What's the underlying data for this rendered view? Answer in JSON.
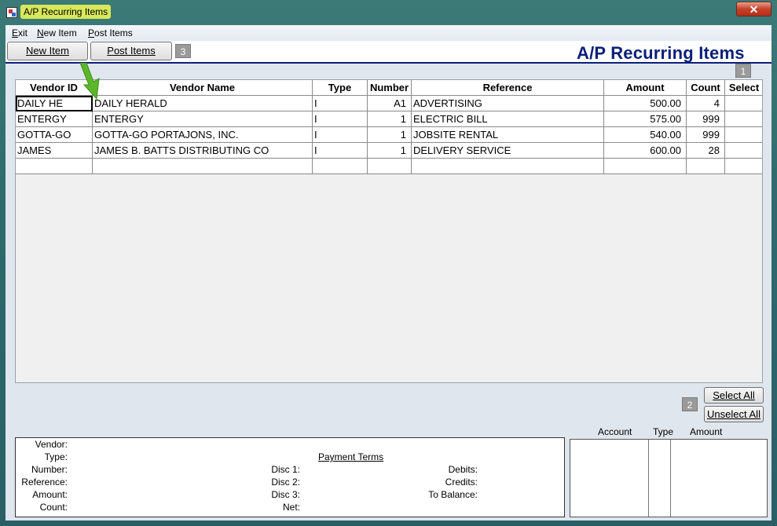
{
  "window": {
    "title": "A/P Recurring Items",
    "close_label": "✕"
  },
  "menu": [
    {
      "label": "Exit",
      "accel": "E",
      "rest": "xit"
    },
    {
      "label": "New Item",
      "accel": "N",
      "rest": "ew Item"
    },
    {
      "label": "Post Items",
      "accel": "P",
      "rest": "ost Items"
    }
  ],
  "toolbar": {
    "new_item_label": "New Item",
    "post_items_label": "Post Items",
    "badge3": "3",
    "heading": "A/P Recurring Items",
    "badge1": "1"
  },
  "grid": {
    "columns": [
      "Vendor ID",
      "Vendor Name",
      "Type",
      "Number",
      "Reference",
      "Amount",
      "Count",
      "Select"
    ],
    "rows": [
      [
        "DAILY HE",
        "DAILY HERALD",
        "I",
        "A1",
        "ADVERTISING",
        "500.00",
        "4",
        ""
      ],
      [
        "ENTERGY",
        "ENTERGY",
        "I",
        "1",
        "ELECTRIC BILL",
        "575.00",
        "999",
        ""
      ],
      [
        "GOTTA-GO",
        "GOTTA-GO PORTAJONS, INC.",
        "I",
        "1",
        "JOBSITE RENTAL",
        "540.00",
        "999",
        ""
      ],
      [
        "JAMES",
        "JAMES B. BATTS DISTRIBUTING CO",
        "I",
        "1",
        "DELIVERY SERVICE",
        "600.00",
        "28",
        ""
      ],
      [
        "",
        "",
        "",
        "",
        "",
        "",
        "",
        ""
      ]
    ]
  },
  "actions": {
    "select_all_label": "Select All",
    "unselect_all_label": "Unselect All",
    "badge2": "2"
  },
  "details": {
    "vendor_label": "Vendor:",
    "type_label": "Type:",
    "number_label": "Number:",
    "reference_label": "Reference:",
    "amount_label": "Amount:",
    "count_label": "Count:",
    "payment_terms_label": "Payment Terms",
    "disc1_label": "Disc 1:",
    "disc2_label": "Disc 2:",
    "disc3_label": "Disc 3:",
    "net_label": "Net:",
    "debits_label": "Debits:",
    "credits_label": "Credits:",
    "to_balance_label": "To Balance:"
  },
  "distribution": {
    "account_label": "Account",
    "type_label": "Type",
    "amount_label": "Amount"
  },
  "colors": {
    "heading": "#0a1f7a",
    "title_highlight": "#d8e85a",
    "annotation_arrow": "#5cb82a",
    "badge": "#9a9a9a"
  }
}
